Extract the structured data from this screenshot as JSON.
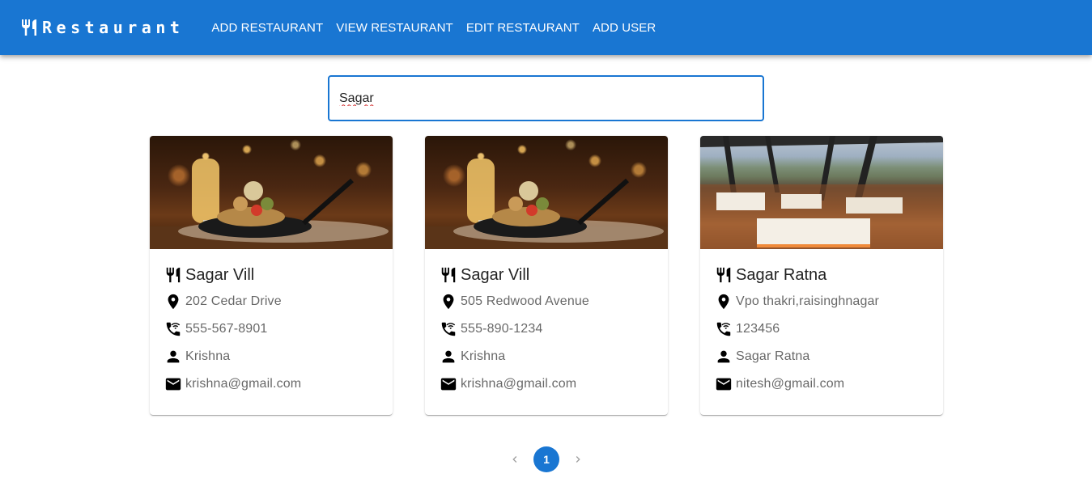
{
  "appbar": {
    "brand": "Restaurant",
    "nav": [
      "ADD RESTAURANT",
      "VIEW RESTAURANT",
      "EDIT RESTAURANT",
      "ADD USER"
    ]
  },
  "search": {
    "value": "Sagar"
  },
  "cards": [
    {
      "name": "Sagar Vill",
      "address": "202 Cedar Drive",
      "phone": "555-567-8901",
      "owner": "Krishna",
      "email": "krishna@gmail.com",
      "image": "food-dish-photo"
    },
    {
      "name": "Sagar Vill",
      "address": "505 Redwood Avenue",
      "phone": "555-890-1234",
      "owner": "Krishna",
      "email": "krishna@gmail.com",
      "image": "food-dish-photo"
    },
    {
      "name": "Sagar Ratna",
      "address": "Vpo thakri,raisinghnagar",
      "phone": "123456",
      "owner": "Sagar Ratna",
      "email": "nitesh@gmail.com",
      "image": "restaurant-interior-view-photo"
    }
  ],
  "pagination": {
    "current": "1"
  },
  "colors": {
    "primary": "#1976d2",
    "white": "#ffffff"
  }
}
